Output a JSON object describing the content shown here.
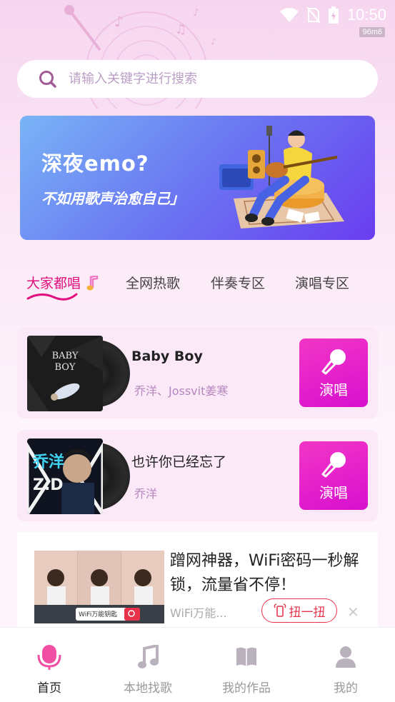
{
  "status_bar": {
    "time": "10:50",
    "badge": "96m6"
  },
  "search": {
    "placeholder": "请输入关键字进行搜索"
  },
  "banner": {
    "title": "深夜emo?",
    "subtitle": "不如用歌声治愈自己」"
  },
  "tabs": [
    {
      "label": "大家都唱"
    },
    {
      "label": "全网热歌"
    },
    {
      "label": "伴奏专区"
    },
    {
      "label": "演唱专区"
    }
  ],
  "songs": [
    {
      "title": "Baby Boy",
      "artist": "乔洋、Jossvit姜寒",
      "sing_label": "演唱",
      "cover_text": "BABY BOY"
    },
    {
      "title": "也许你已经忘了",
      "artist": "乔洋",
      "sing_label": "演唱",
      "cover_text": "乔洋"
    }
  ],
  "ad": {
    "text": "蹭网神器，WiFi密码一秒解锁，流量省不停！",
    "source": "WiFi万能...",
    "button_label": "扭一扭",
    "close": "✕",
    "image_caption": "WiFi万能钥匙"
  },
  "nav": [
    {
      "label": "首页",
      "icon": "microphone-icon",
      "active": true
    },
    {
      "label": "本地找歌",
      "icon": "music-note-icon",
      "active": false
    },
    {
      "label": "我的作品",
      "icon": "book-icon",
      "active": false
    },
    {
      "label": "我的",
      "icon": "user-icon",
      "active": false
    }
  ],
  "colors": {
    "accent": "#e0107d",
    "sing_button": "#e71ccd",
    "ad_red": "#e8334a"
  }
}
